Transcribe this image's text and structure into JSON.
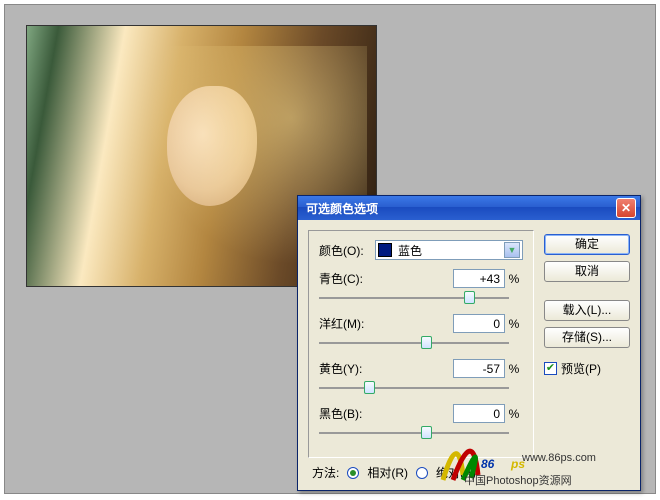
{
  "dialog": {
    "title": "可选颜色选项",
    "color_label": "颜色(O):",
    "color_value": "蓝色",
    "buttons": {
      "ok": "确定",
      "cancel": "取消",
      "load": "载入(L)...",
      "save": "存储(S)..."
    },
    "preview_label": "预览(P)",
    "preview_checked": true,
    "sliders": {
      "cyan": {
        "label": "青色(C):",
        "value": "+43",
        "pct": "%",
        "pos": 71
      },
      "magenta": {
        "label": "洋红(M):",
        "value": "0",
        "pct": "%",
        "pos": 50
      },
      "yellow": {
        "label": "黄色(Y):",
        "value": "-57",
        "pct": "%",
        "pos": 22
      },
      "black": {
        "label": "黑色(B):",
        "value": "0",
        "pct": "%",
        "pos": 50
      }
    },
    "method": {
      "label": "方法:",
      "relative": "相对(R)",
      "absolute": "绝对(A)",
      "selected": "relative"
    }
  },
  "watermark": {
    "url": "www.86ps.com",
    "text": "中国Photoshop资源网"
  }
}
